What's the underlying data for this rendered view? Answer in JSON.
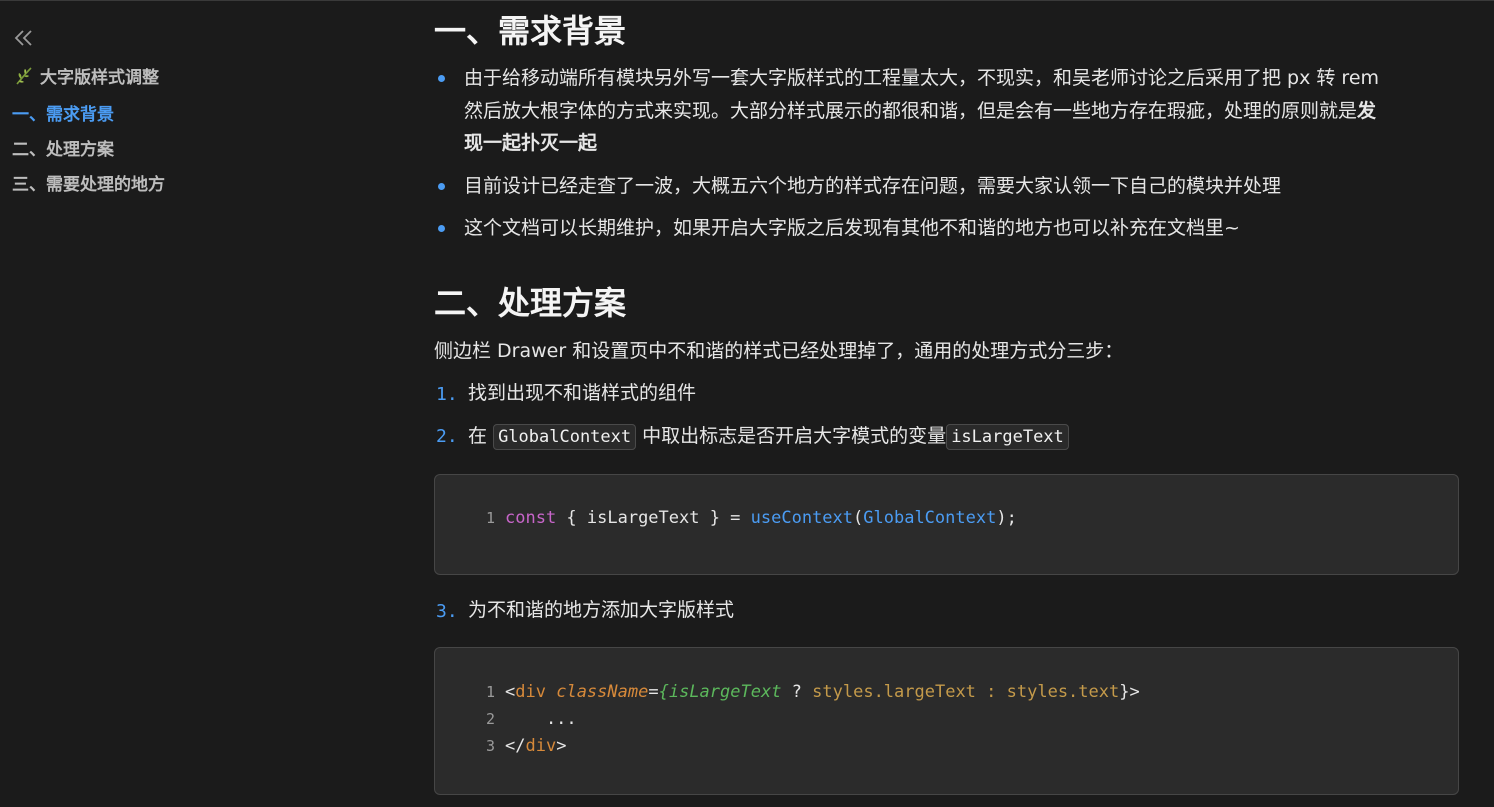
{
  "sidebar": {
    "doc_title": "大字版样式调整",
    "items": [
      {
        "label": "一、需求背景",
        "active": true
      },
      {
        "label": "二、处理方案",
        "active": false
      },
      {
        "label": "三、需要处理的地方",
        "active": false
      }
    ]
  },
  "content": {
    "section1": {
      "heading": "一、需求背景",
      "bullets": {
        "b1_line1": "由于给移动端所有模块另外写一套大字版样式的工程量太大，不现实，和吴老师讨论之后采用了把 px 转 rem",
        "b1_line2_normal": "然后放大根字体的方式来实现。大部分样式展示的都很和谐，但是会有一些地方存在瑕疵，处理的原则就是",
        "b1_line2_bold": "发",
        "b1_line3_bold": "现一起扑灭一起",
        "b2": "目前设计已经走查了一波，大概五六个地方的样式存在问题，需要大家认领一下自己的模块并处理",
        "b3": "这个文档可以长期维护，如果开启大字版之后发现有其他不和谐的地方也可以补充在文档里~"
      }
    },
    "section2": {
      "heading": "二、处理方案",
      "intro": "侧边栏 Drawer 和设置页中不和谐的样式已经处理掉了，通用的处理方式分三步：",
      "steps": {
        "s1_num": "1.",
        "s1_text": "找到出现不和谐样式的组件",
        "s2_num": "2.",
        "s2_pre": "在",
        "s2_code1": "GlobalContext",
        "s2_mid": "中取出标志是否开启大字模式的变量",
        "s2_code2": "isLargeText",
        "s3_num": "3.",
        "s3_text": "为不和谐的地方添加大字版样式"
      },
      "code1": {
        "ln1": "1",
        "kw": "const",
        "p1": " { isLargeText } = ",
        "fn": "useContext",
        "p2": "(",
        "arg": "GlobalContext",
        "p3": ");"
      },
      "code2": {
        "ln1": "1",
        "ln2": "2",
        "ln3": "3",
        "open_lt": "<",
        "tag": "div",
        "attr": "className",
        "eq": "=",
        "brace_open": "{",
        "expr": "isLargeText",
        "q": " ? ",
        "m1": "styles.largeText",
        "colon": " : ",
        "m2": "styles.text",
        "brace_close": "}",
        "gt": ">",
        "dots": "    ...",
        "close_lt": "</",
        "close_tag": "div",
        "close_gt": ">"
      }
    }
  }
}
